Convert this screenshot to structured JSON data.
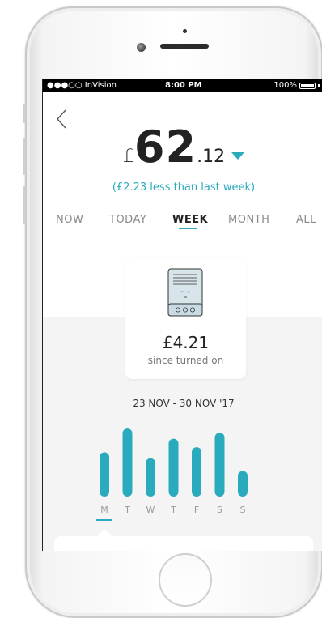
{
  "status_bar": {
    "carrier": "●●●○○ InVision",
    "time": "8:00 PM",
    "battery": "100%"
  },
  "summary": {
    "currency": "£",
    "amount_whole": "62",
    "amount_decimal": ".12",
    "comparison": "(£2.23 less than last week)"
  },
  "tabs": [
    {
      "label": "NOW",
      "active": false
    },
    {
      "label": "TODAY",
      "active": false
    },
    {
      "label": "WEEK",
      "active": true
    },
    {
      "label": "MONTH",
      "active": false
    },
    {
      "label": "ALL",
      "active": false
    }
  ],
  "device_card": {
    "value": "£4.21",
    "label": "since turned on",
    "icon": "heater-device-icon"
  },
  "chart_data": {
    "type": "bar",
    "title": "23 NOV - 30 NOV '17",
    "categories": [
      "M",
      "T",
      "W",
      "T",
      "F",
      "S",
      "S"
    ],
    "values": [
      52,
      80,
      45,
      68,
      58,
      75,
      30
    ],
    "selected_index": 0,
    "color": "#2aaabd"
  },
  "colors": {
    "accent": "#2aaabd",
    "text": "#222222",
    "muted": "#8a8a8a"
  }
}
